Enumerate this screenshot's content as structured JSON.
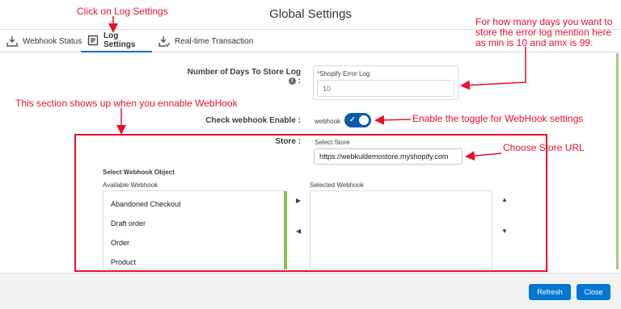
{
  "modal": {
    "title": "Global Settings"
  },
  "annotations": {
    "click_log_settings": "Click on Log Settings",
    "days_note": "For how many days you want to store the error log mention here as min is 10 and amx is 99.",
    "section_note": "This section shows up when you ennable WebHook",
    "toggle_note": "Enable the toggle for WebHook settings",
    "store_note": "Choose Store URL"
  },
  "tabs": [
    {
      "label": "Webhook Status",
      "icon": "download-icon"
    },
    {
      "label": "Log Settings",
      "icon": "document-icon",
      "active": true
    },
    {
      "label": "Real-time Transaction",
      "icon": "download-check-icon"
    }
  ],
  "log": {
    "label": "Number of Days To Store Log",
    "colon": ":",
    "legend": "Shopify Error Log",
    "required_mark": "*",
    "placeholder": "10"
  },
  "webhook": {
    "label": "Check webhook Enable :",
    "toggle_label": "webhook",
    "enabled": true
  },
  "store": {
    "label": "Store :",
    "select_label": "Select Store",
    "value": "https://webkuldemostore.myshopify.com"
  },
  "webhook_object": {
    "title": "Select Webhook Object",
    "available_label": "Available Webhook",
    "selected_label": "Selected Webhook",
    "available": [
      "Abandoned Checkout",
      "Draft order",
      "Order",
      "Product"
    ],
    "selected": []
  },
  "footer": {
    "refresh": "Refresh",
    "close": "Close"
  },
  "colors": {
    "accent": "#0176d3",
    "annotation": "#e8112d",
    "toggle": "#0b5cab"
  }
}
